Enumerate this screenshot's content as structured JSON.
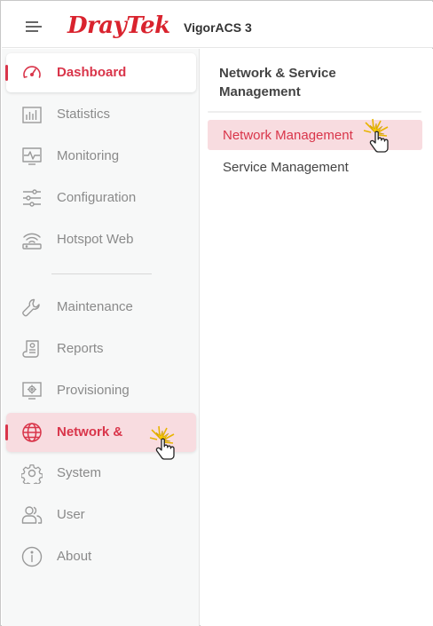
{
  "header": {
    "logo_text": "DrayTek",
    "product_name": "VigorACS 3",
    "menu_icon": "hamburger-menu-icon"
  },
  "sidebar": {
    "items": [
      {
        "label": "Dashboard",
        "icon": "speedometer-icon",
        "state": "active"
      },
      {
        "label": "Statistics",
        "icon": "bar-chart-icon",
        "state": "normal"
      },
      {
        "label": "Monitoring",
        "icon": "monitor-pulse-icon",
        "state": "normal"
      },
      {
        "label": "Configuration",
        "icon": "sliders-icon",
        "state": "normal"
      },
      {
        "label": "Hotspot Web",
        "icon": "wifi-router-icon",
        "state": "normal"
      },
      {
        "label": "Maintenance",
        "icon": "wrench-icon",
        "state": "normal"
      },
      {
        "label": "Reports",
        "icon": "report-scroll-icon",
        "state": "normal"
      },
      {
        "label": "Provisioning",
        "icon": "provisioning-gear-icon",
        "state": "normal"
      },
      {
        "label": "Network &",
        "icon": "globe-icon",
        "state": "hover"
      },
      {
        "label": "System",
        "icon": "gear-icon",
        "state": "normal"
      },
      {
        "label": "User",
        "icon": "users-icon",
        "state": "normal"
      },
      {
        "label": "About",
        "icon": "info-icon",
        "state": "normal"
      }
    ]
  },
  "submenu": {
    "title": "Network & Service Management",
    "items": [
      {
        "label": "Network Management",
        "state": "hover"
      },
      {
        "label": "Service Management",
        "state": "normal"
      }
    ]
  },
  "colors": {
    "brand_red": "#d9232e",
    "accent": "#d9354a",
    "hover_bg": "#f8dce0",
    "sidebar_bg": "#f7f8f8",
    "icon_gray": "#9a9a9a"
  }
}
